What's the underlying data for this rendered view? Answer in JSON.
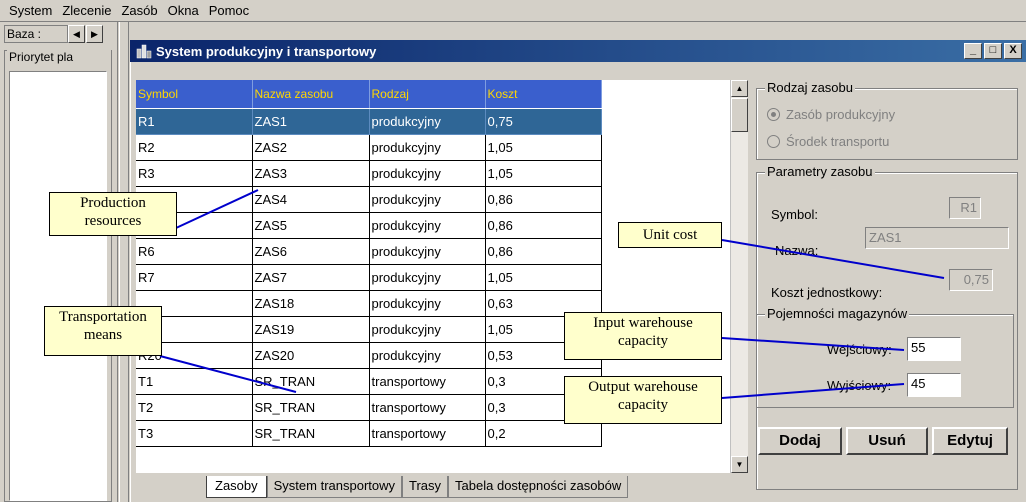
{
  "menubar": {
    "items": [
      "System",
      "Zlecenie",
      "Zasób",
      "Okna",
      "Pomoc"
    ]
  },
  "leftpanel": {
    "tab_label": "Baza :",
    "group_title": "Priorytet pla"
  },
  "window": {
    "title": "System produkcyjny i transportowy",
    "buttons": [
      "_",
      "□",
      "X"
    ]
  },
  "grid": {
    "columns": [
      "Symbol",
      "Nazwa zasobu",
      "Rodzaj",
      "Koszt"
    ],
    "rows": [
      [
        "R1",
        "ZAS1",
        "produkcyjny",
        "0,75"
      ],
      [
        "R2",
        "ZAS2",
        "produkcyjny",
        "1,05"
      ],
      [
        "R3",
        "ZAS3",
        "produkcyjny",
        "1,05"
      ],
      [
        "",
        "ZAS4",
        "produkcyjny",
        "0,86"
      ],
      [
        "",
        "ZAS5",
        "produkcyjny",
        "0,86"
      ],
      [
        "R6",
        "ZAS6",
        "produkcyjny",
        "0,86"
      ],
      [
        "R7",
        "ZAS7",
        "produkcyjny",
        "1,05"
      ],
      [
        "",
        "ZAS18",
        "produkcyjny",
        "0,63"
      ],
      [
        "",
        "ZAS19",
        "produkcyjny",
        "1,05"
      ],
      [
        "R20",
        "ZAS20",
        "produkcyjny",
        "0,53"
      ],
      [
        "T1",
        "SR_TRAN",
        "transportowy",
        "0,3"
      ],
      [
        "T2",
        "SR_TRAN",
        "transportowy",
        "0,3"
      ],
      [
        "T3",
        "SR_TRAN",
        "transportowy",
        "0,2"
      ]
    ],
    "selected_row": 0
  },
  "right": {
    "rodzaj_title": "Rodzaj zasobu",
    "radio_produkcyjny": "Zasób produkcyjny",
    "radio_transport": "Środek transportu",
    "params_title": "Parametry zasobu",
    "symbol_label": "Symbol:",
    "symbol_value": "R1",
    "nazwa_label": "Nazwa:",
    "nazwa_value": "ZAS1",
    "koszt_label": "Koszt jednostkowy:",
    "koszt_value": "0,75",
    "magazyny_title": "Pojemności magazynów",
    "wejsciowy_label": "Wejściowy:",
    "wejsciowy_value": "55",
    "wyjsciowy_label": "Wyjściowy:",
    "wyjsciowy_value": "45",
    "dodaj": "Dodaj",
    "usun": "Usuń",
    "edytuj": "Edytuj"
  },
  "tabs": [
    "Zasoby",
    "System transportowy",
    "Trasy",
    "Tabela dostępności zasobów"
  ],
  "callouts": {
    "production": "Production resources",
    "transportation": "Transportation means",
    "unit_cost": "Unit cost",
    "input": "Input warehouse capacity",
    "output": "Output warehouse capacity"
  }
}
